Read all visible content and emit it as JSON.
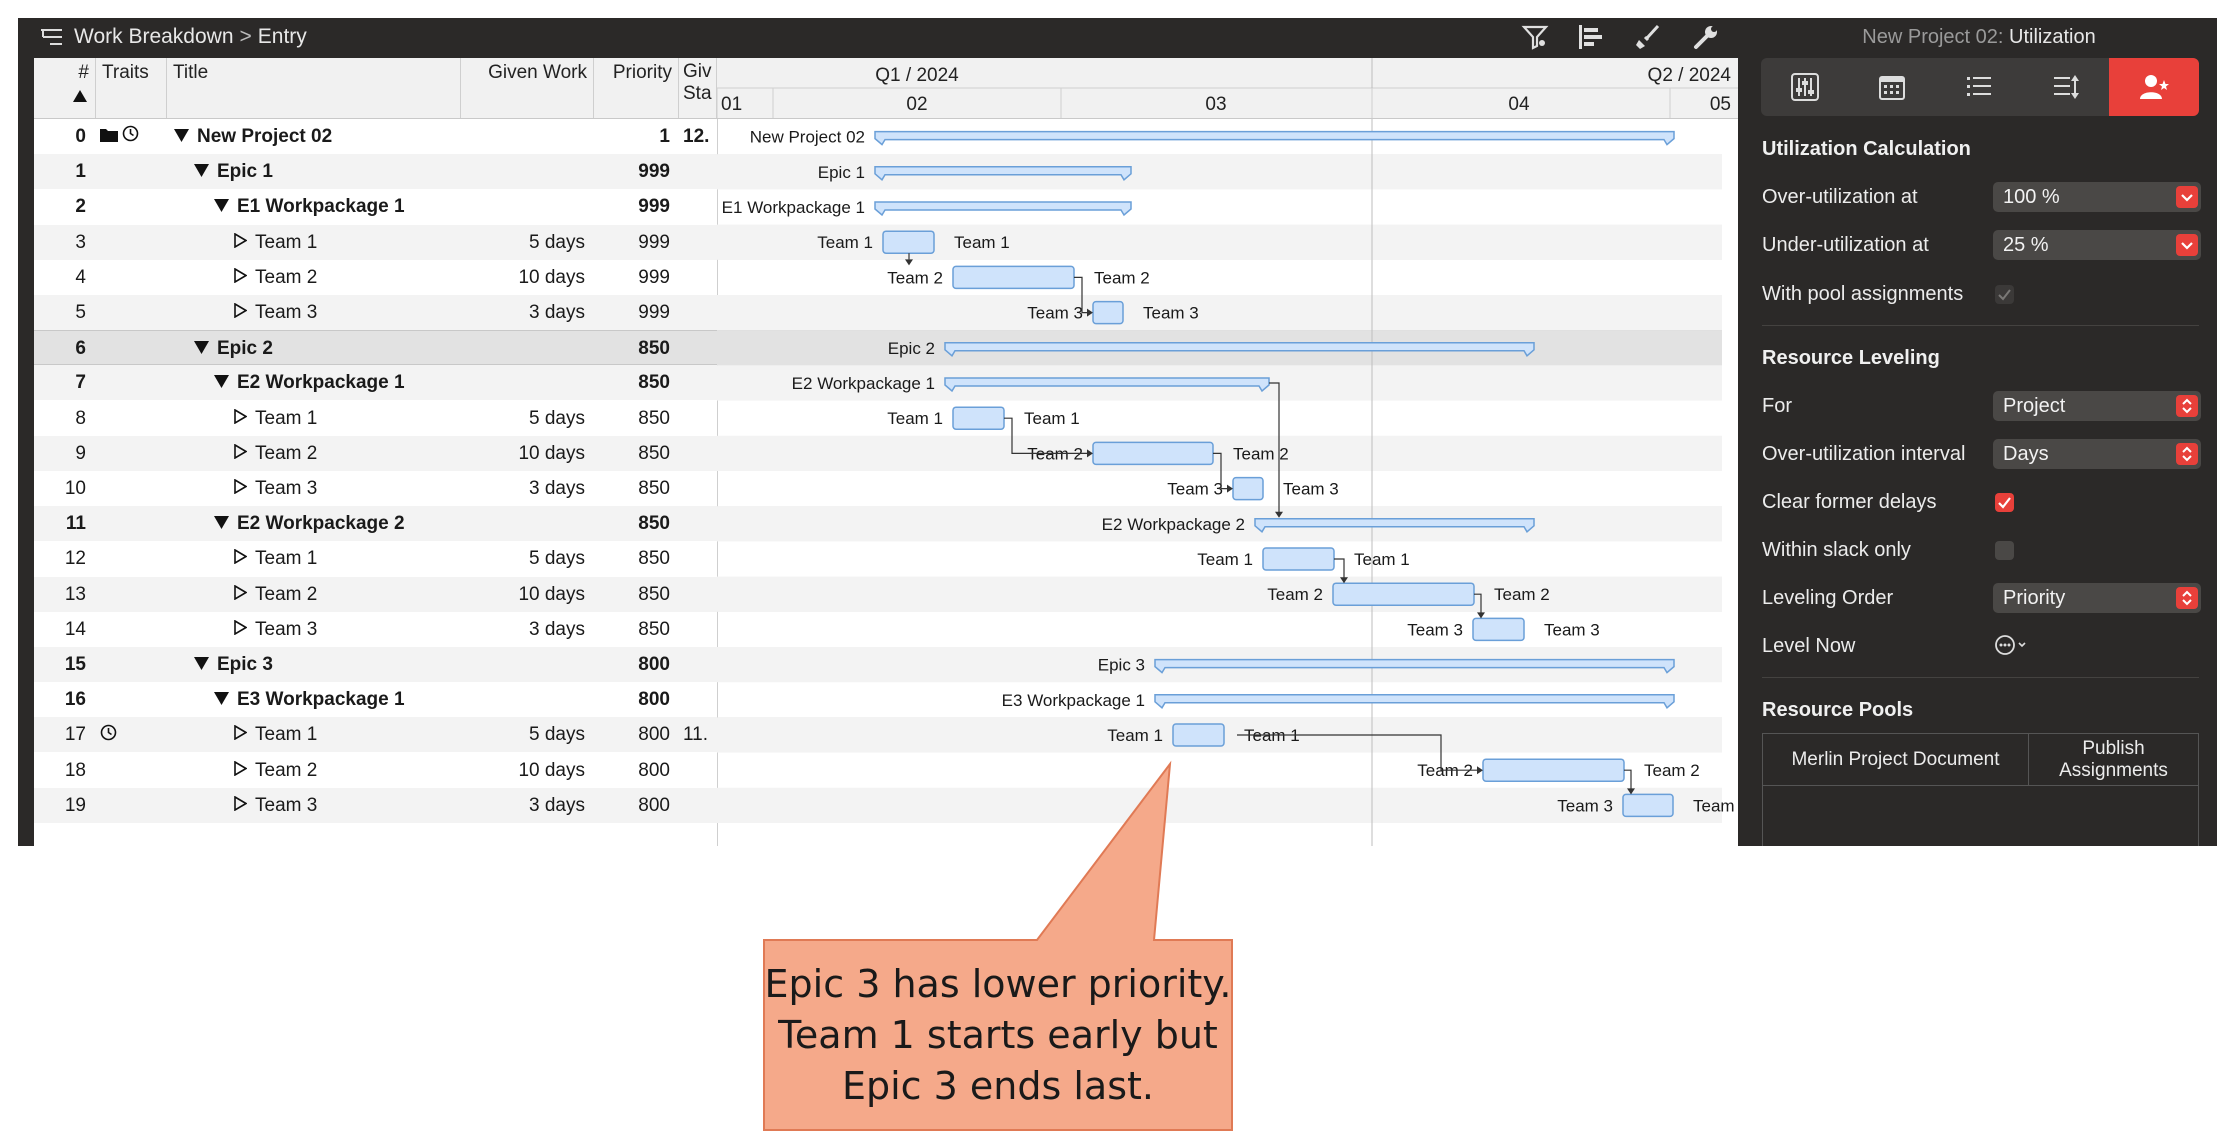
{
  "toolbar": {
    "breadcrumb_root": "Work Breakdown",
    "breadcrumb_separator": ">",
    "breadcrumb_current": "Entry",
    "tools": [
      "filter-icon",
      "gantt-icon",
      "brush-icon",
      "wrench-icon"
    ]
  },
  "table": {
    "columns": {
      "num": "#",
      "traits": "Traits",
      "title": "Title",
      "given_work": "Given Work",
      "priority": "Priority",
      "given_start": "Giv Sta"
    },
    "rows": [
      {
        "num": "0",
        "traits": "folder,clock",
        "title": "New Project 02",
        "level": 0,
        "expand": "open",
        "bold": true,
        "work": "",
        "priority": "1",
        "start": "12."
      },
      {
        "num": "1",
        "traits": "",
        "title": "Epic 1",
        "level": 1,
        "expand": "open",
        "bold": true,
        "work": "",
        "priority": "999",
        "start": ""
      },
      {
        "num": "2",
        "traits": "",
        "title": "E1 Workpackage 1",
        "level": 2,
        "expand": "open",
        "bold": true,
        "work": "",
        "priority": "999",
        "start": ""
      },
      {
        "num": "3",
        "traits": "",
        "title": "Team 1",
        "level": 3,
        "expand": "closed",
        "bold": false,
        "work": "5 days",
        "priority": "999",
        "start": ""
      },
      {
        "num": "4",
        "traits": "",
        "title": "Team 2",
        "level": 3,
        "expand": "closed",
        "bold": false,
        "work": "10 days",
        "priority": "999",
        "start": ""
      },
      {
        "num": "5",
        "traits": "",
        "title": "Team 3",
        "level": 3,
        "expand": "closed",
        "bold": false,
        "work": "3 days",
        "priority": "999",
        "start": ""
      },
      {
        "num": "6",
        "traits": "",
        "title": "Epic 2",
        "level": 1,
        "expand": "open",
        "bold": true,
        "work": "",
        "priority": "850",
        "start": ""
      },
      {
        "num": "7",
        "traits": "",
        "title": "E2 Workpackage 1",
        "level": 2,
        "expand": "open",
        "bold": true,
        "work": "",
        "priority": "850",
        "start": ""
      },
      {
        "num": "8",
        "traits": "",
        "title": "Team 1",
        "level": 3,
        "expand": "closed",
        "bold": false,
        "work": "5 days",
        "priority": "850",
        "start": ""
      },
      {
        "num": "9",
        "traits": "",
        "title": "Team 2",
        "level": 3,
        "expand": "closed",
        "bold": false,
        "work": "10 days",
        "priority": "850",
        "start": ""
      },
      {
        "num": "10",
        "traits": "",
        "title": "Team 3",
        "level": 3,
        "expand": "closed",
        "bold": false,
        "work": "3 days",
        "priority": "850",
        "start": ""
      },
      {
        "num": "11",
        "traits": "",
        "title": "E2 Workpackage 2",
        "level": 2,
        "expand": "open",
        "bold": true,
        "work": "",
        "priority": "850",
        "start": ""
      },
      {
        "num": "12",
        "traits": "",
        "title": "Team 1",
        "level": 3,
        "expand": "closed",
        "bold": false,
        "work": "5 days",
        "priority": "850",
        "start": ""
      },
      {
        "num": "13",
        "traits": "",
        "title": "Team 2",
        "level": 3,
        "expand": "closed",
        "bold": false,
        "work": "10 days",
        "priority": "850",
        "start": ""
      },
      {
        "num": "14",
        "traits": "",
        "title": "Team 3",
        "level": 3,
        "expand": "closed",
        "bold": false,
        "work": "3 days",
        "priority": "850",
        "start": ""
      },
      {
        "num": "15",
        "traits": "",
        "title": "Epic 3",
        "level": 1,
        "expand": "open",
        "bold": true,
        "work": "",
        "priority": "800",
        "start": ""
      },
      {
        "num": "16",
        "traits": "",
        "title": "E3 Workpackage 1",
        "level": 2,
        "expand": "open",
        "bold": true,
        "work": "",
        "priority": "800",
        "start": ""
      },
      {
        "num": "17",
        "traits": "clock",
        "title": "Team 1",
        "level": 3,
        "expand": "closed",
        "bold": false,
        "work": "5 days",
        "priority": "800",
        "start": "11."
      },
      {
        "num": "18",
        "traits": "",
        "title": "Team 2",
        "level": 3,
        "expand": "closed",
        "bold": false,
        "work": "10 days",
        "priority": "800",
        "start": ""
      },
      {
        "num": "19",
        "traits": "",
        "title": "Team 3",
        "level": 3,
        "expand": "closed",
        "bold": false,
        "work": "3 days",
        "priority": "800",
        "start": ""
      }
    ]
  },
  "gantt": {
    "quarters": [
      "Q1 / 2024",
      "Q2 / 2024"
    ],
    "months": [
      "01",
      "02",
      "03",
      "04",
      "05"
    ],
    "bar_fill": "#cfe3fb",
    "bar_stroke": "#6a9fd8",
    "summary_labels": [
      "New Project 02",
      "Epic 1",
      "E1 Workpackage 1",
      "Epic 2",
      "E2 Workpackage 1",
      "E2 Workpackage 2",
      "Epic 3",
      "E3 Workpackage 1"
    ],
    "team_labels": [
      "Team 1",
      "Team 2",
      "Team 3"
    ]
  },
  "inspector": {
    "title_prefix": "New Project 02:",
    "title_view": "Utilization",
    "tabs": [
      "sliders-icon",
      "calendar-icon",
      "list-icon",
      "priority-list-icon",
      "resource-person-icon"
    ],
    "utilization": {
      "heading": "Utilization Calculation",
      "over_label": "Over-utilization at",
      "over_value": "100 %",
      "under_label": "Under-utilization at",
      "under_value": "25 %",
      "pool_label": "With pool assignments",
      "pool_checked": true
    },
    "leveling": {
      "heading": "Resource Leveling",
      "for_label": "For",
      "for_value": "Project",
      "interval_label": "Over-utilization interval",
      "interval_value": "Days",
      "clear_label": "Clear former delays",
      "clear_checked": true,
      "slack_label": "Within slack only",
      "slack_checked": false,
      "order_label": "Leveling Order",
      "order_value": "Priority",
      "level_now_label": "Level Now"
    },
    "pools": {
      "heading": "Resource Pools",
      "col1": "Merlin Project Document",
      "col2": "Publish Assignments"
    },
    "accent": "#e8403a"
  },
  "callout": {
    "lines": [
      "Epic 3 has lower priority.",
      "Team 1 starts early but",
      "Epic 3 ends last."
    ],
    "fill": "#f5a98a",
    "stroke": "#e07a55"
  }
}
